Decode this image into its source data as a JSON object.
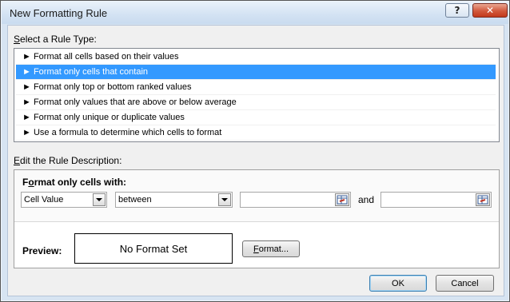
{
  "window": {
    "title": "New Formatting Rule"
  },
  "titlebar": {
    "help_glyph": "?",
    "close_glyph": "✕"
  },
  "rule_type": {
    "label_prefix": "",
    "label_access_key": "S",
    "label_rest": "elect a Rule Type:",
    "items": [
      {
        "arrow": "►",
        "label": "Format all cells based on their values",
        "selected": false
      },
      {
        "arrow": "►",
        "label": "Format only cells that contain",
        "selected": true
      },
      {
        "arrow": "►",
        "label": "Format only top or bottom ranked values",
        "selected": false
      },
      {
        "arrow": "►",
        "label": "Format only values that are above or below average",
        "selected": false
      },
      {
        "arrow": "►",
        "label": "Format only unique or duplicate values",
        "selected": false
      },
      {
        "arrow": "►",
        "label": "Use a formula to determine which cells to format",
        "selected": false
      }
    ]
  },
  "description": {
    "label_access_key": "E",
    "label_rest": "dit the Rule Description:",
    "heading_prefix": "F",
    "heading_access_key": "o",
    "heading_rest": "rmat only cells with:",
    "condition_type": "Cell Value",
    "operator": "between",
    "value1": "",
    "value2": "",
    "and_label": "and",
    "preview_label": "Preview:",
    "preview_text": "No Format Set",
    "format_button_access_key": "F",
    "format_button_rest": "ormat..."
  },
  "footer": {
    "ok_label": "OK",
    "cancel_label": "Cancel"
  },
  "colors": {
    "selection": "#3399ff",
    "dialog_bg": "#f0f0f0",
    "frame": "#d7e4f2"
  }
}
